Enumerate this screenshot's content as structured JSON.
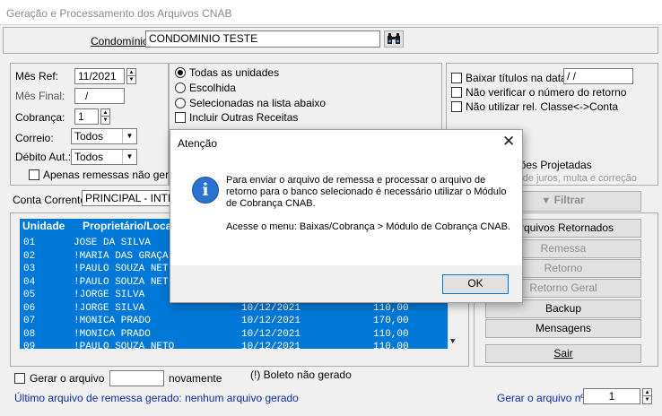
{
  "window": {
    "title": "Geração e Processamento dos Arquivos CNAB"
  },
  "condominio": {
    "label": "Condomínio:",
    "value": "CONDOMINIO TESTE",
    "search_icon": "binoculars-icon"
  },
  "filters": {
    "mes_ref_label": "Mês Ref:",
    "mes_ref_value": "11/2021",
    "mes_final_label": "Mês Final:",
    "mes_final_value": "/",
    "cobranca_label": "Cobrança:",
    "cobranca_value": "1",
    "correio_label": "Correio:",
    "correio_value": "Todos",
    "debito_label": "Débito Aut.:",
    "debito_value": "Todos",
    "apenas_label": "Apenas remessas não geradas"
  },
  "units": {
    "todas": "Todas as unidades",
    "escolhida": "Escolhida",
    "selecionadas": "Selecionadas na lista abaixo",
    "incluir": "Incluir Outras Receitas"
  },
  "options": {
    "baixar": "Baixar títulos na data:",
    "baixar_value": " / /",
    "nao_verificar": "Não verificar o número do retorno",
    "nao_utilizar": "Não utilizar rel. Classe<->Conta",
    "correcoes": "rreções Projetadas",
    "correcoes_sub": "es de juros, multa e correção",
    "filtrar": "Filtrar"
  },
  "conta": {
    "label": "Conta Corrente:",
    "value": "PRINCIPAL - INTER"
  },
  "grid": {
    "headers": [
      "Unidade",
      "Proprietário/Loca"
    ],
    "rows": [
      {
        "un": "01",
        "nome": " JOSE DA SILVA",
        "data": "",
        "valor": ""
      },
      {
        "un": "02",
        "nome": "!MARIA DAS GRAÇA",
        "data": "",
        "valor": ""
      },
      {
        "un": "03",
        "nome": "!PAULO SOUZA NET",
        "data": "",
        "valor": ""
      },
      {
        "un": "04",
        "nome": "!PAULO SOUZA NET",
        "data": "",
        "valor": ""
      },
      {
        "un": "05",
        "nome": "!JORGE SILVA",
        "data": "",
        "valor": ""
      },
      {
        "un": "06",
        "nome": "!JORGE SILVA",
        "data": "10/12/2021",
        "valor": "110,00"
      },
      {
        "un": "07",
        "nome": "!MONICA PRADO",
        "data": "10/12/2021",
        "valor": "170,00"
      },
      {
        "un": "08",
        "nome": "!MONICA PRADO",
        "data": "10/12/2021",
        "valor": "110,00"
      },
      {
        "un": "09",
        "nome": "!PAULO SOUZA NETO",
        "data": "10/12/2021",
        "valor": "110,00"
      }
    ]
  },
  "actions": {
    "arquivos_retornados": "Arquivos Retornados",
    "remessa": "Remessa",
    "retorno": "Retorno",
    "retorno_geral": "Retorno Geral",
    "backup": "Backup",
    "mensagens": "Mensagens",
    "sair": "Sair"
  },
  "footer": {
    "gerar_label": "Gerar o arquivo",
    "novamente": "novamente",
    "boleto_nao_gerado": "(!) Boleto não gerado",
    "ultimo_arquivo": "Último arquivo de remessa gerado:  nenhum arquivo gerado",
    "gerar_n_label": "Gerar o arquivo nº:",
    "gerar_n_value": "1"
  },
  "dialog": {
    "title": "Atenção",
    "message1": "Para enviar o arquivo de remessa e processar o arquivo de retorno para o banco selecionado é necessário utilizar o Módulo de Cobrança CNAB.",
    "message2": "Acesse o menu: Baixas/Cobrança > Módulo de Cobrança CNAB.",
    "ok": "OK"
  }
}
